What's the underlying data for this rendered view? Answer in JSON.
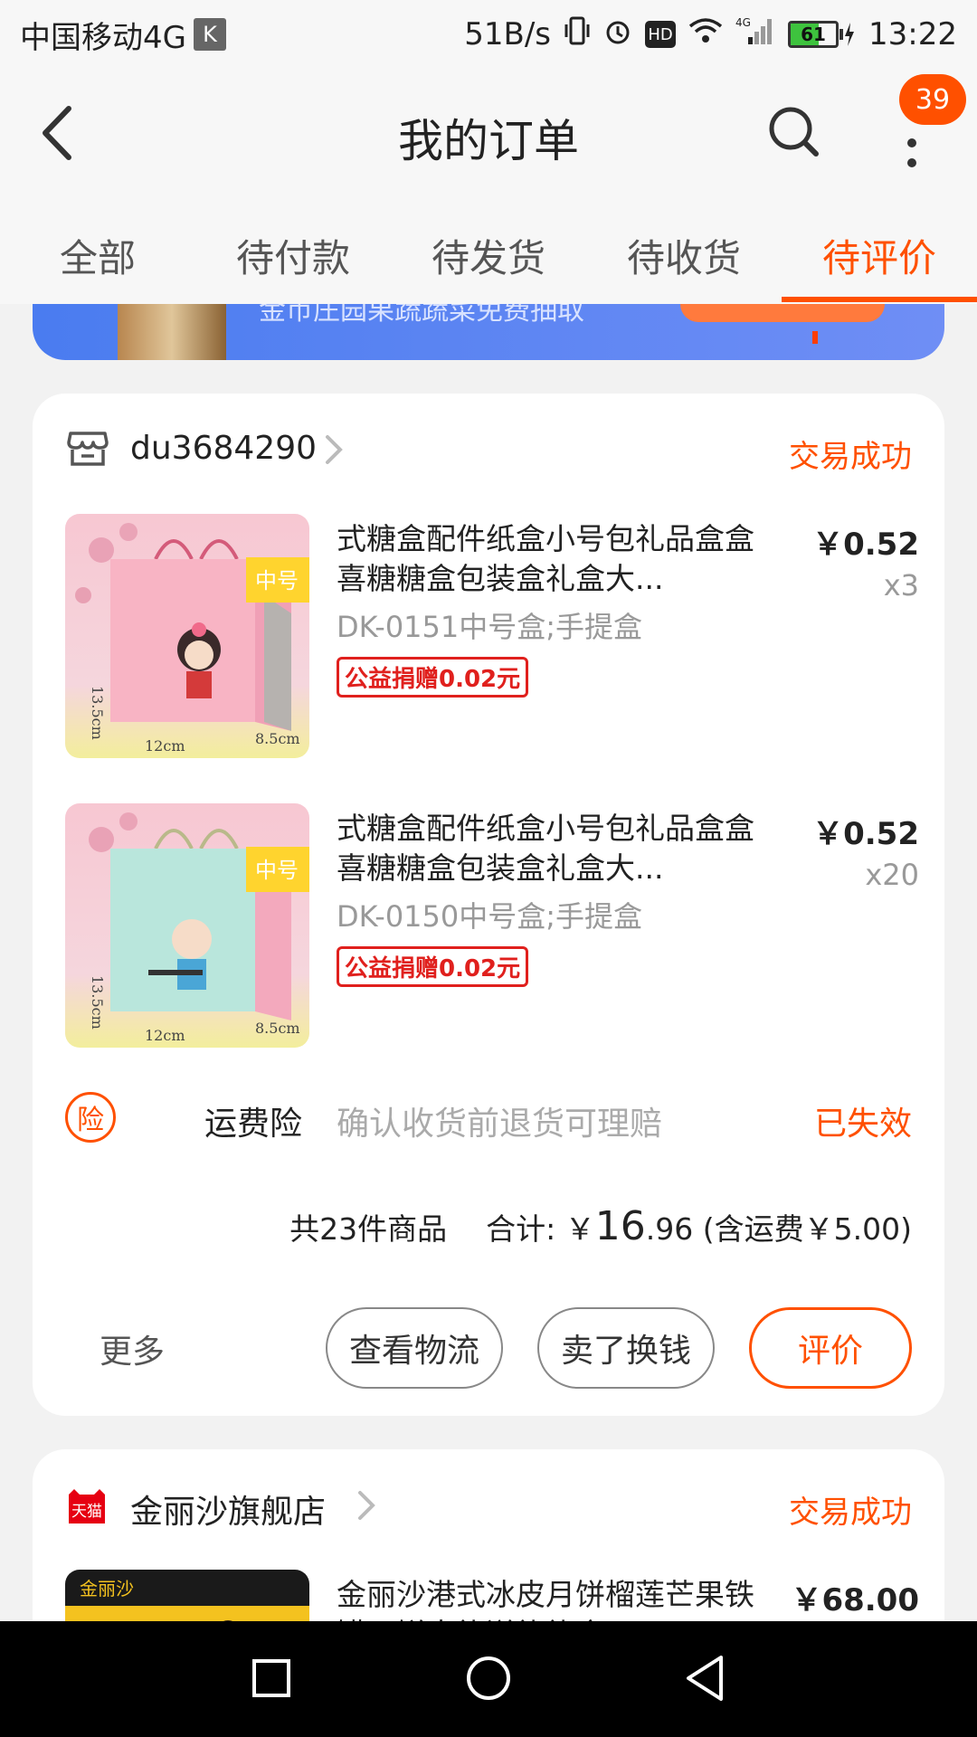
{
  "status_bar": {
    "carrier": "中国移动4G",
    "carrier_badge": "K",
    "speed": "51B/s",
    "hd": "HD",
    "network": "4G",
    "battery": "61",
    "battery_level": 0.61,
    "time": "13:22"
  },
  "header": {
    "title": "我的订单",
    "badge": "39"
  },
  "tabs": [
    {
      "label": "全部"
    },
    {
      "label": "待付款"
    },
    {
      "label": "待发货"
    },
    {
      "label": "待收货"
    },
    {
      "label": "待评价",
      "active": true
    }
  ],
  "banner": {
    "text": "金币庄园果蔬蔬菜免费抽取"
  },
  "orders": [
    {
      "shop_name": "du3684290",
      "status": "交易成功",
      "items": [
        {
          "title": "式糖盒配件纸盒小号包礼品盒盒喜糖糖盒包装盒礼盒大...",
          "sku": "DK-0151中号盒;手提盒",
          "tag": "公益捐赠0.02元",
          "price": "￥0.52",
          "qty": "x3"
        },
        {
          "title": "式糖盒配件纸盒小号包礼品盒盒喜糖糖盒包装盒礼盒大...",
          "sku": "DK-0150中号盒;手提盒",
          "tag": "公益捐赠0.02元",
          "price": "￥0.52",
          "qty": "x20"
        }
      ],
      "insurance": {
        "icon": "险",
        "label": "运费险",
        "desc": "确认收货前退货可理赔",
        "status": "已失效"
      },
      "summary": {
        "count": "共23件商品",
        "total_label": "合计: ￥",
        "total_int": "16",
        "total_dec": ".96",
        "shipping": "(含运费￥5.00)"
      },
      "actions": {
        "more": "更多",
        "logistics": "查看物流",
        "sell": "卖了换钱",
        "review": "评价"
      }
    },
    {
      "shop_name": "金丽沙旗舰店",
      "shop_badge": "天猫",
      "status": "交易成功",
      "items": [
        {
          "title": "金丽沙港式冰皮月饼榴莲芒果铁罐月饼大礼送礼礼盒",
          "price": "￥68.00"
        }
      ]
    }
  ],
  "colors": {
    "accent": "#ff5000",
    "tag_red": "#e0201d",
    "background": "#f2f2f2"
  }
}
